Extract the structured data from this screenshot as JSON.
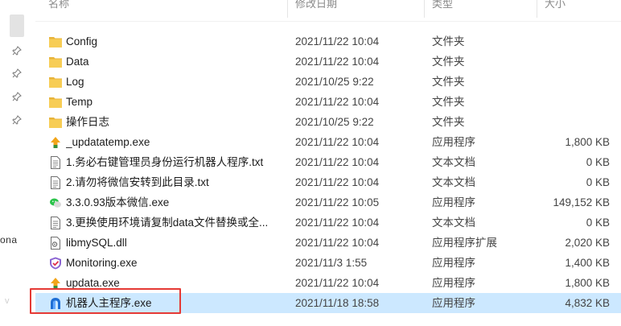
{
  "header": {
    "name_col": "名称",
    "date_col": "修改日期",
    "type_col": "类型",
    "size_col": "大小"
  },
  "sidebar": {
    "pins": [
      "pin-icon",
      "pin-icon",
      "pin-icon",
      "pin-icon"
    ],
    "partial_label": "ona",
    "faint_label": "v"
  },
  "files": [
    {
      "name": "Config",
      "date": "2021/11/22 10:04",
      "type": "文件夹",
      "size": "",
      "icon": "folder-icon"
    },
    {
      "name": "Data",
      "date": "2021/11/22 10:04",
      "type": "文件夹",
      "size": "",
      "icon": "folder-icon"
    },
    {
      "name": "Log",
      "date": "2021/10/25 9:22",
      "type": "文件夹",
      "size": "",
      "icon": "folder-icon"
    },
    {
      "name": "Temp",
      "date": "2021/11/22 10:04",
      "type": "文件夹",
      "size": "",
      "icon": "folder-icon"
    },
    {
      "name": "操作日志",
      "date": "2021/10/25 9:22",
      "type": "文件夹",
      "size": "",
      "icon": "folder-icon"
    },
    {
      "name": "_updatatemp.exe",
      "date": "2021/11/22 10:04",
      "type": "应用程序",
      "size": "1,800 KB",
      "icon": "update-arrow-icon"
    },
    {
      "name": "1.务必右键管理员身份运行机器人程序.txt",
      "date": "2021/11/22 10:04",
      "type": "文本文档",
      "size": "0 KB",
      "icon": "text-file-icon"
    },
    {
      "name": "2.请勿将微信安转到此目录.txt",
      "date": "2021/11/22 10:04",
      "type": "文本文档",
      "size": "0 KB",
      "icon": "text-file-icon"
    },
    {
      "name": "3.3.0.93版本微信.exe",
      "date": "2021/11/22 10:05",
      "type": "应用程序",
      "size": "149,152 KB",
      "icon": "wechat-icon"
    },
    {
      "name": "3.更换使用环境请复制data文件替换或全...",
      "date": "2021/11/22 10:04",
      "type": "文本文档",
      "size": "0 KB",
      "icon": "text-file-icon"
    },
    {
      "name": "libmySQL.dll",
      "date": "2021/11/22 10:04",
      "type": "应用程序扩展",
      "size": "2,020 KB",
      "icon": "dll-file-icon"
    },
    {
      "name": "Monitoring.exe",
      "date": "2021/11/3 1:55",
      "type": "应用程序",
      "size": "1,400 KB",
      "icon": "shield-icon"
    },
    {
      "name": "updata.exe",
      "date": "2021/11/22 10:04",
      "type": "应用程序",
      "size": "1,800 KB",
      "icon": "update-arrow-icon"
    },
    {
      "name": "机器人主程序.exe",
      "date": "2021/11/18 18:58",
      "type": "应用程序",
      "size": "4,832 KB",
      "icon": "robot-app-icon",
      "selected": true
    }
  ],
  "colors": {
    "folder": "#f5c54a",
    "selection": "#cce8ff",
    "highlight_border": "#e53935"
  }
}
